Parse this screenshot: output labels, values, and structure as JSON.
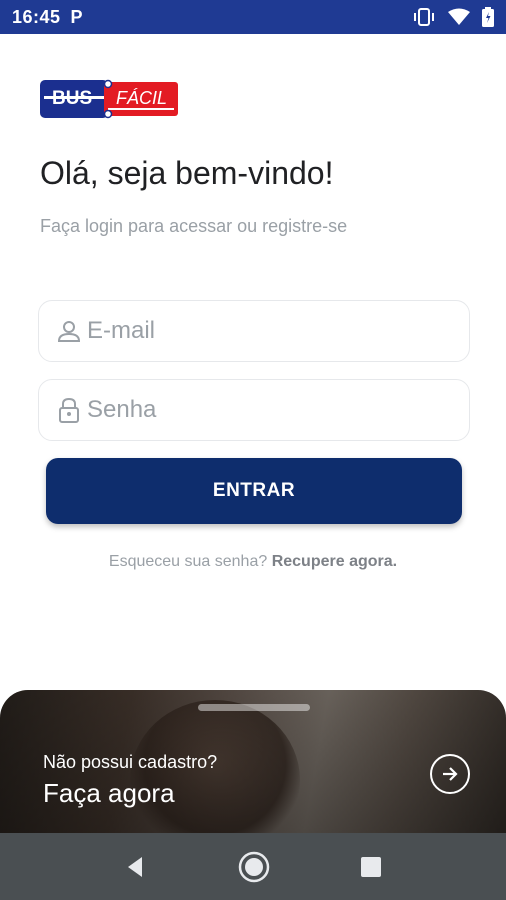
{
  "status_bar": {
    "time": "16:45",
    "notification_letter": "P"
  },
  "app": {
    "logo": {
      "primary_text": "BUS",
      "secondary_text": "FÁCIL"
    },
    "welcome_title": "Olá, seja bem-vindo!",
    "subtitle": "Faça login para acessar ou registre-se"
  },
  "form": {
    "email_placeholder": "E-mail",
    "password_placeholder": "Senha",
    "submit_label": "ENTRAR"
  },
  "forgot": {
    "question": "Esqueceu sua senha?",
    "link": "Recupere agora."
  },
  "banner": {
    "question": "Não possui cadastro?",
    "cta": "Faça agora"
  },
  "nav": {
    "icons": [
      "back-icon",
      "home-icon",
      "recents-icon"
    ]
  },
  "colors": {
    "status_bar": "#1f3a93",
    "primary_button": "#0e2d6d",
    "logo_blue": "#1b2f8f",
    "logo_red": "#e31b23",
    "nav_bar": "#4a4f52"
  }
}
